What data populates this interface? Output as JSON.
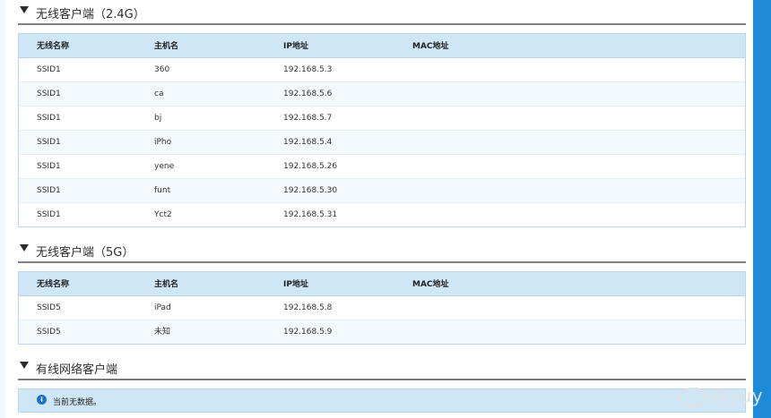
{
  "sections": [
    {
      "title": "无线客户端（2.4G）",
      "headers": [
        "无线名称",
        "主机名",
        "IP地址",
        "MAC地址"
      ],
      "rows": [
        {
          "ssid": "SSID1",
          "host": "360",
          "ip": "192.168.5.3",
          "mac": ""
        },
        {
          "ssid": "SSID1",
          "host": "ca",
          "ip": "192.168.5.6",
          "mac": ""
        },
        {
          "ssid": "SSID1",
          "host": "bj",
          "ip": "192.168.5.7",
          "mac": ""
        },
        {
          "ssid": "SSID1",
          "host": "iPho",
          "ip": "192.168.5.4",
          "mac": ""
        },
        {
          "ssid": "SSID1",
          "host": "yene",
          "ip": "192.168.5.26",
          "mac": ""
        },
        {
          "ssid": "SSID1",
          "host": "funt",
          "ip": "192.168.5.30",
          "mac": ""
        },
        {
          "ssid": "SSID1",
          "host": "Yct2",
          "ip": "192.168.5.31",
          "mac": ""
        }
      ]
    },
    {
      "title": "无线客户端（5G）",
      "headers": [
        "无线名称",
        "主机名",
        "IP地址",
        "MAC地址"
      ],
      "rows": [
        {
          "ssid": "SSID5",
          "host": "iPad",
          "ip": "192.168.5.8",
          "mac": ""
        },
        {
          "ssid": "SSID5",
          "host": "未知",
          "ip": "192.168.5.9",
          "mac": ""
        }
      ]
    },
    {
      "title": "有线网络客户端",
      "empty_message": "当前无数据。"
    }
  ],
  "watermark": "skyuy",
  "colors": {
    "accent": "#1f8ad8",
    "header_bg": "#cfe6f7"
  }
}
